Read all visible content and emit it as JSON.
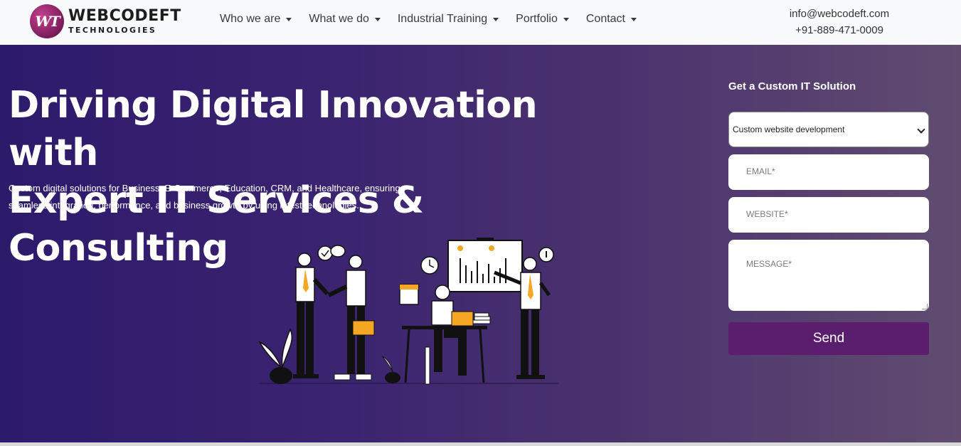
{
  "brand": {
    "logo_mark": "WT",
    "name": "WEBCODEFT",
    "subname": "TECHNOLOGIES"
  },
  "nav": {
    "items": [
      {
        "label": "Who we are"
      },
      {
        "label": "What we do"
      },
      {
        "label": "Industrial Training"
      },
      {
        "label": "Portfolio"
      },
      {
        "label": "Contact"
      }
    ]
  },
  "contact": {
    "email": "info@webcodeft.com",
    "phone": "+91-889-471-0009"
  },
  "hero": {
    "title_line1": "Driving Digital Innovation with",
    "title_line2": "Expert IT Services & Consulting",
    "desc_line1": "Custom digital solutions for Business, E-Commerce, Education, CRM, and Healthcare, ensuring",
    "desc_line2": "seamless integration, performance, and business growth by using latest technologies."
  },
  "form": {
    "title": "Get a Custom IT Solution",
    "service_selected": "Custom website development",
    "email_placeholder": "EMAIL*",
    "website_placeholder": "WEBSITE*",
    "message_placeholder": "MESSAGE*",
    "send_label": "Send"
  },
  "colors": {
    "hero_start": "#2c1a6b",
    "hero_end": "#614c70",
    "button": "#5b1e6e",
    "accent_orange": "#f5a623"
  }
}
